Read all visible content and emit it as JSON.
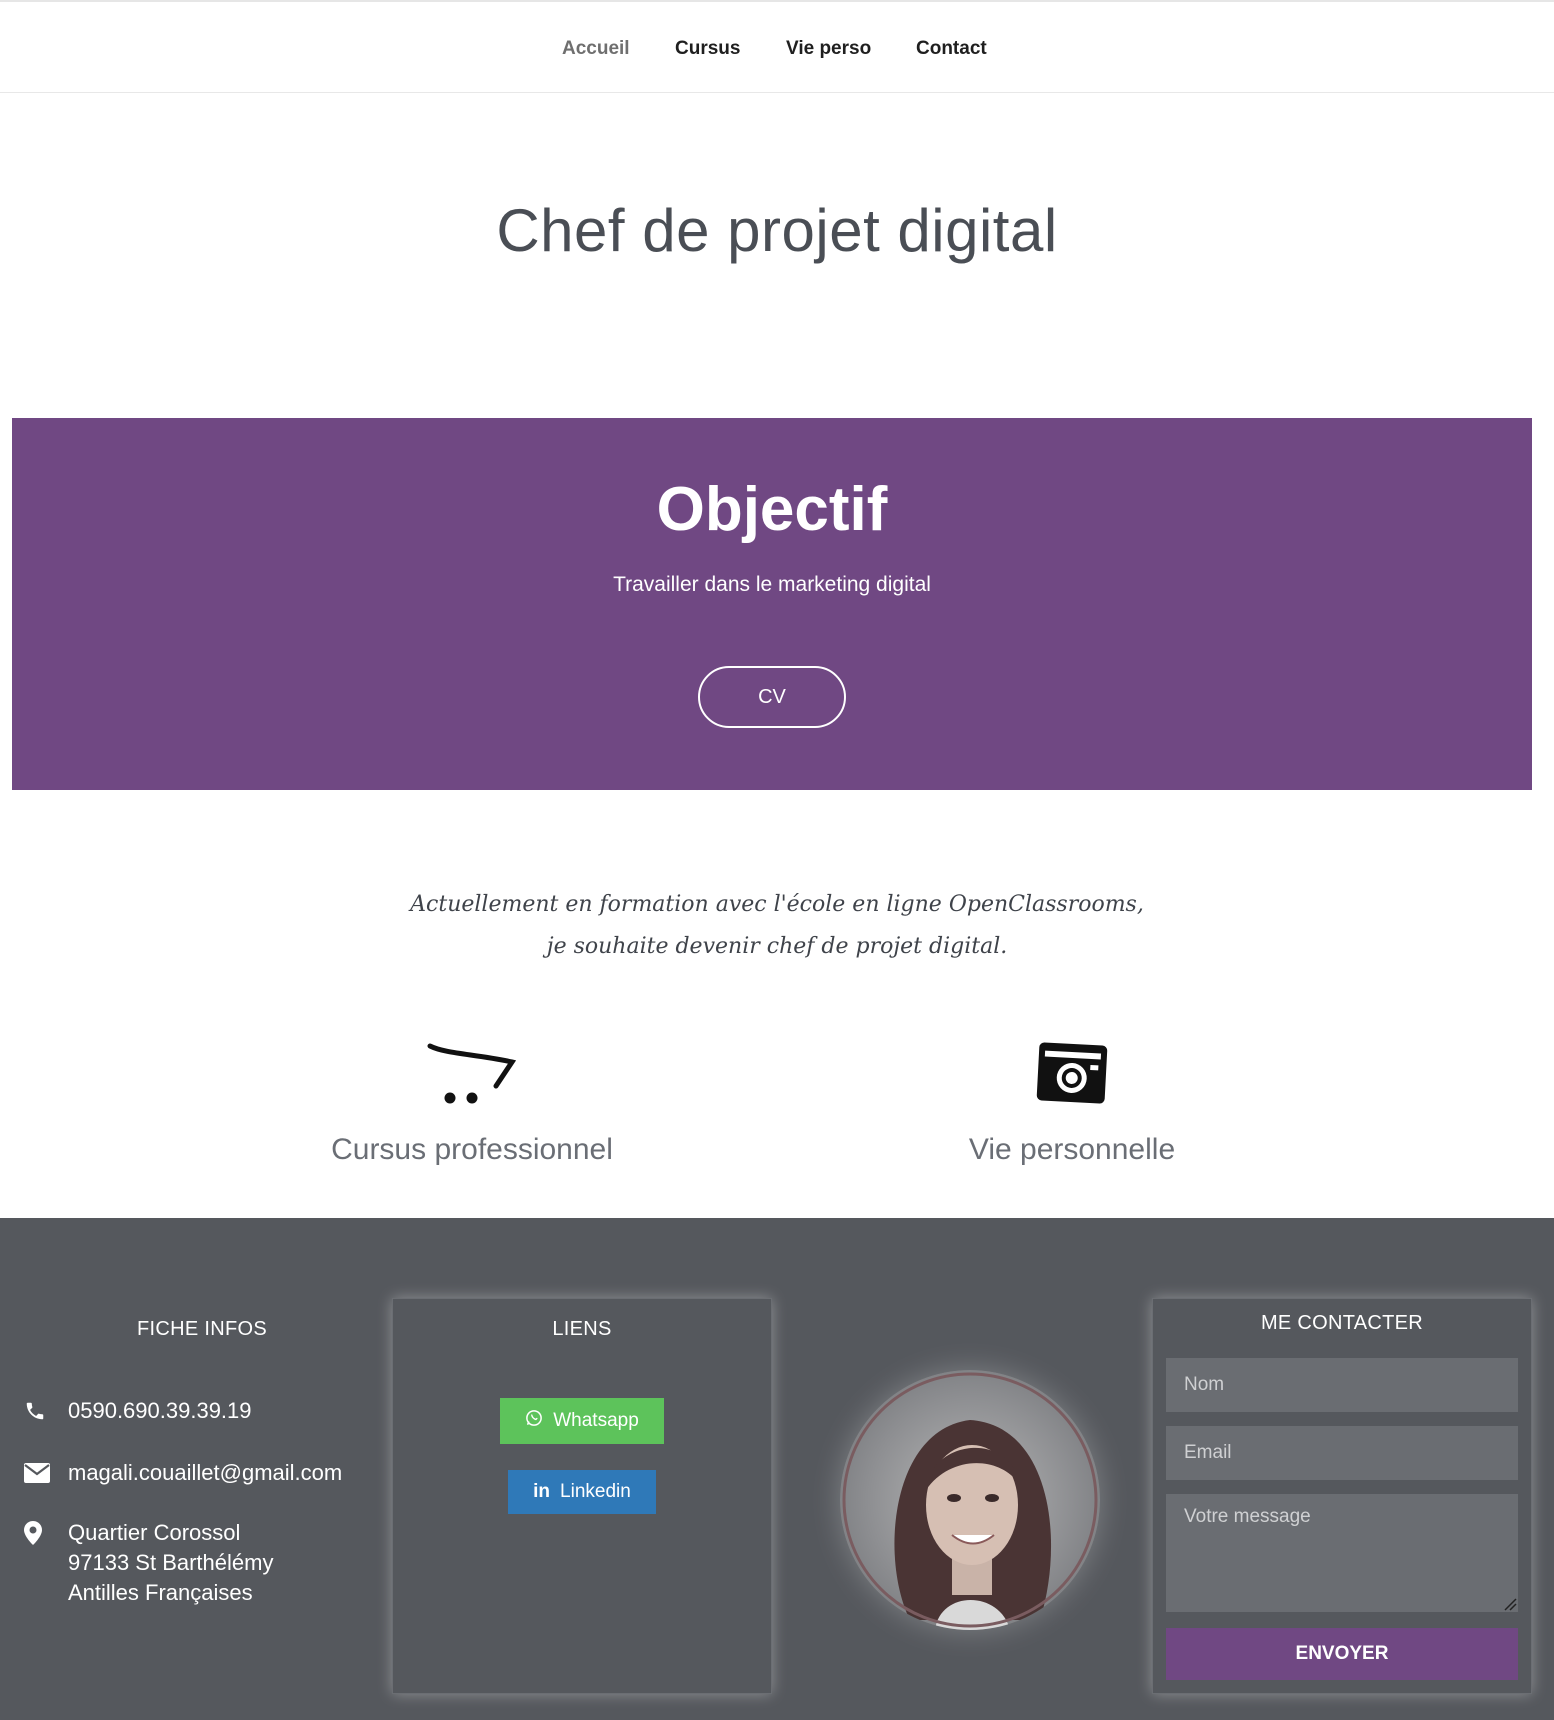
{
  "nav": {
    "items": [
      {
        "label": "Accueil"
      },
      {
        "label": "Cursus"
      },
      {
        "label": "Vie perso"
      },
      {
        "label": "Contact"
      }
    ]
  },
  "hero": {
    "title": "Chef de projet digital"
  },
  "objectif": {
    "title": "Objectif",
    "subtitle": "Travailler dans le marketing digital",
    "cv_button": "CV",
    "bg_color": "#704883"
  },
  "intro": {
    "line1": "Actuellement en formation avec l'école en ligne OpenClassrooms,",
    "line2": "je souhaite devenir chef de projet digital."
  },
  "features": [
    {
      "icon": "shopping-cart-icon",
      "label": "Cursus professionnel"
    },
    {
      "icon": "camera-icon",
      "label": "Vie personnelle"
    }
  ],
  "footer": {
    "info": {
      "title": "FICHE INFOS",
      "phone": "0590.690.39.39.19",
      "email": "magali.couaillet@gmail.com",
      "address_line1": "Quartier Corossol",
      "address_line2": "97133 St Barthélémy",
      "address_line3": "Antilles Françaises"
    },
    "links": {
      "title": "LIENS",
      "whatsapp": "Whatsapp",
      "linkedin": "Linkedin"
    },
    "contact": {
      "title": "ME CONTACTER",
      "name_placeholder": "Nom",
      "email_placeholder": "Email",
      "message_placeholder": "Votre message",
      "send_label": "ENVOYER"
    }
  },
  "colors": {
    "accent": "#704883",
    "footer_bg": "#55585d",
    "whatsapp": "#5dc35b",
    "linkedin": "#2f79b8"
  }
}
